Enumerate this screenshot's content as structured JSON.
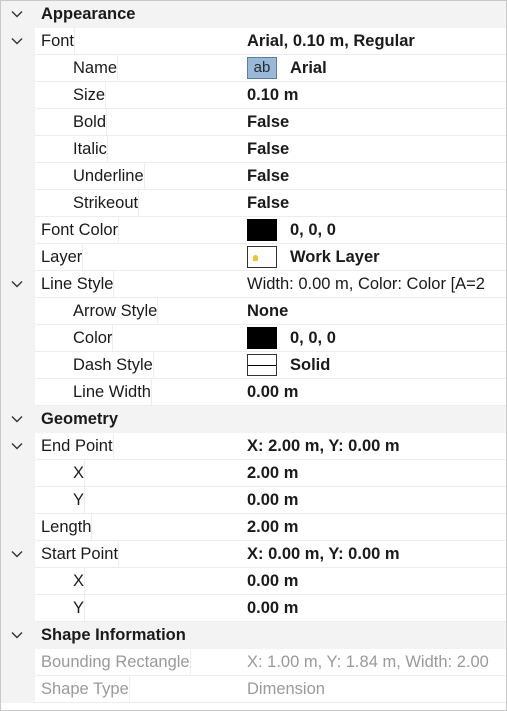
{
  "categories": {
    "appearance": "Appearance",
    "geometry": "Geometry",
    "shape_information": "Shape Information"
  },
  "font": {
    "label": "Font",
    "value": "Arial, 0.10 m, Regular",
    "name_label": "Name",
    "name_preview": "ab",
    "name_value": "Arial",
    "size_label": "Size",
    "size_value": "0.10 m",
    "bold_label": "Bold",
    "bold_value": "False",
    "italic_label": "Italic",
    "italic_value": "False",
    "underline_label": "Underline",
    "underline_value": "False",
    "strikeout_label": "Strikeout",
    "strikeout_value": "False"
  },
  "font_color": {
    "label": "Font Color",
    "value": "0, 0, 0",
    "swatch": "#000000"
  },
  "layer": {
    "label": "Layer",
    "value": "Work Layer"
  },
  "line_style": {
    "label": "Line Style",
    "value": "Width: 0.00 m, Color: Color [A=2",
    "arrow_label": "Arrow Style",
    "arrow_value": "None",
    "color_label": "Color",
    "color_value": "0, 0, 0",
    "color_swatch": "#000000",
    "dash_label": "Dash Style",
    "dash_value": "Solid",
    "width_label": "Line Width",
    "width_value": "0.00 m"
  },
  "end_point": {
    "label": "End Point",
    "value": "X: 2.00 m, Y: 0.00 m",
    "x_label": "X",
    "x_value": "2.00 m",
    "y_label": "Y",
    "y_value": "0.00 m"
  },
  "length": {
    "label": "Length",
    "value": "2.00 m"
  },
  "start_point": {
    "label": "Start Point",
    "value": "X: 0.00 m, Y: 0.00 m",
    "x_label": "X",
    "x_value": "0.00 m",
    "y_label": "Y",
    "y_value": "0.00 m"
  },
  "bounding_rectangle": {
    "label": "Bounding Rectangle",
    "value": "X: 1.00 m, Y: 1.84 m, Width: 2.00"
  },
  "shape_type": {
    "label": "Shape Type",
    "value": "Dimension"
  }
}
